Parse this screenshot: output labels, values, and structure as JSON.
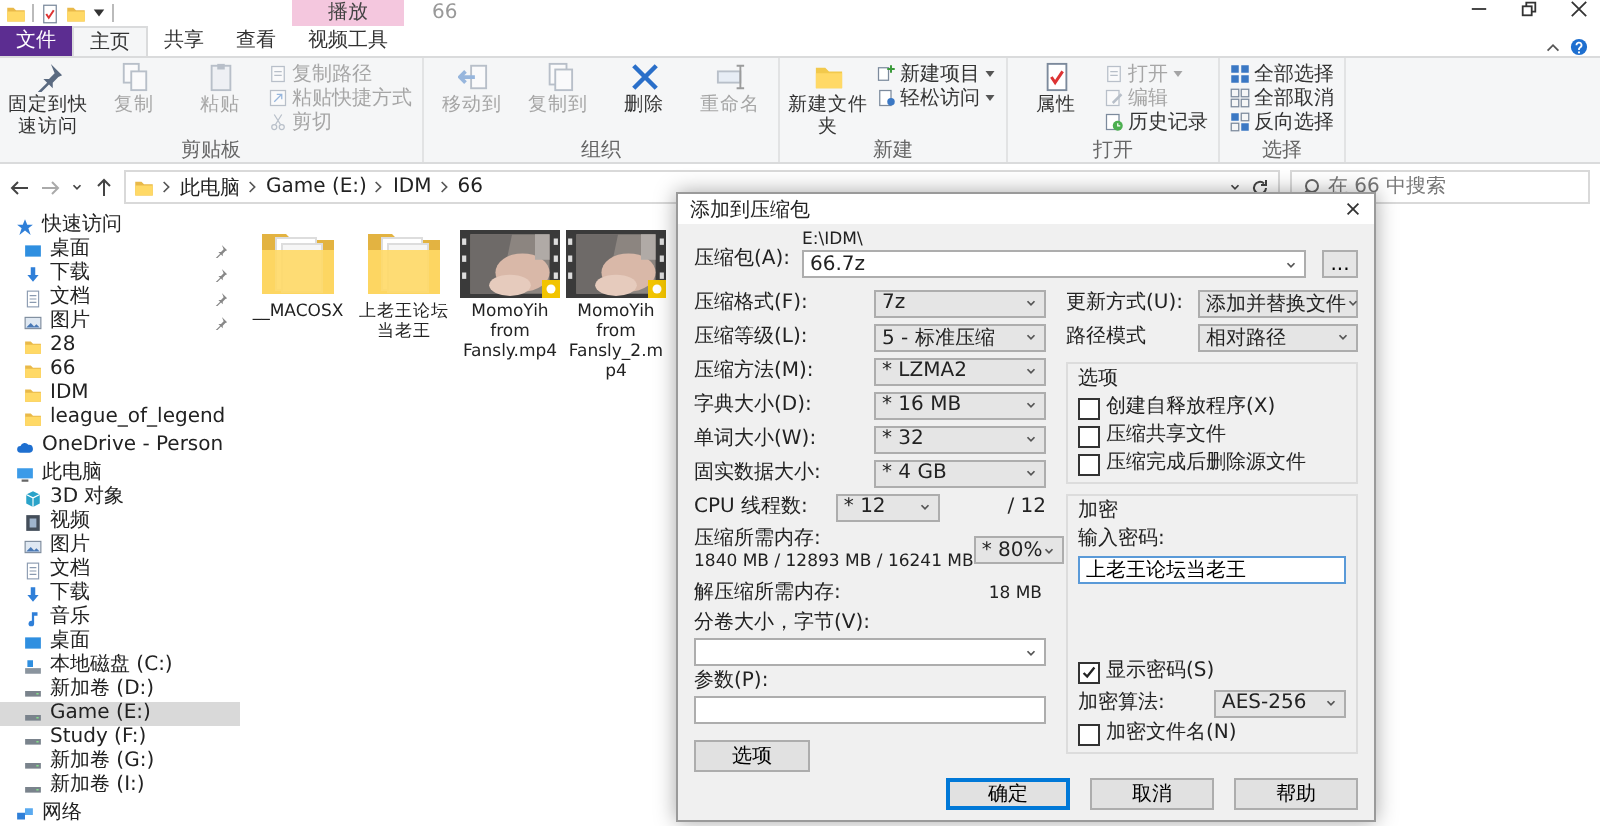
{
  "title_bar": {
    "title": "66"
  },
  "tabs": [
    {
      "label": "文件",
      "kind": "menu",
      "selected": false
    },
    {
      "label": "主页",
      "kind": "tab",
      "selected": true
    },
    {
      "label": "共享",
      "kind": "tab",
      "selected": false
    },
    {
      "label": "查看",
      "kind": "tab",
      "selected": false
    },
    {
      "label": "视频工具",
      "kind": "contextual",
      "header": "播放",
      "selected": false
    }
  ],
  "ribbon": {
    "groups": [
      {
        "label": "剪贴板",
        "large": [
          {
            "label": "固定到快速访问",
            "kind": "pin",
            "disabled": false
          },
          {
            "label": "复制",
            "kind": "copy",
            "disabled": true
          },
          {
            "label": "粘贴",
            "kind": "paste",
            "disabled": true
          }
        ],
        "small": [
          {
            "label": "复制路径",
            "kind": "path",
            "disabled": true,
            "dropdown": false
          },
          {
            "label": "粘贴快捷方式",
            "kind": "shortcut",
            "disabled": true,
            "dropdown": false
          },
          {
            "label": "剪切",
            "kind": "cut",
            "disabled": true,
            "dropdown": false
          }
        ]
      },
      {
        "label": "组织",
        "large": [
          {
            "label": "移动到",
            "kind": "move",
            "disabled": true
          },
          {
            "label": "复制到",
            "kind": "copyto",
            "disabled": true
          },
          {
            "label": "删除",
            "kind": "delete",
            "disabled": false
          },
          {
            "label": "重命名",
            "kind": "rename",
            "disabled": true
          }
        ]
      },
      {
        "label": "新建",
        "large": [
          {
            "label": "新建文件夹",
            "kind": "newfolder",
            "disabled": false
          }
        ],
        "small": [
          {
            "label": "新建项目",
            "kind": "newitem",
            "disabled": false,
            "dropdown": true
          },
          {
            "label": "轻松访问",
            "kind": "easy",
            "disabled": false,
            "dropdown": true
          }
        ]
      },
      {
        "label": "打开",
        "large": [
          {
            "label": "属性",
            "kind": "props",
            "disabled": false
          }
        ],
        "small": [
          {
            "label": "打开",
            "kind": "open",
            "disabled": true,
            "dropdown": true
          },
          {
            "label": "编辑",
            "kind": "edit",
            "disabled": true,
            "dropdown": false
          },
          {
            "label": "历史记录",
            "kind": "history",
            "disabled": false,
            "dropdown": false
          }
        ]
      },
      {
        "label": "选择",
        "small": [
          {
            "label": "全部选择",
            "kind": "selectall",
            "disabled": false,
            "dropdown": false
          },
          {
            "label": "全部取消",
            "kind": "selectnone",
            "disabled": false,
            "dropdown": false
          },
          {
            "label": "反向选择",
            "kind": "invert",
            "disabled": false,
            "dropdown": false
          }
        ]
      }
    ]
  },
  "address_bar": {
    "crumbs": [
      "此电脑",
      "Game (E:)",
      "IDM",
      "66"
    ],
    "search_placeholder": "在 66 中搜索"
  },
  "sidebar": {
    "sections": [
      {
        "label": "快速访问",
        "kind": "star",
        "selected": false,
        "children": [
          {
            "label": "桌面",
            "kind": "desktop",
            "pinned": true,
            "selected": false
          },
          {
            "label": "下载",
            "kind": "download",
            "pinned": true,
            "selected": false
          },
          {
            "label": "文档",
            "kind": "doc",
            "pinned": true,
            "selected": false
          },
          {
            "label": "图片",
            "kind": "picture",
            "pinned": true,
            "selected": false
          },
          {
            "label": "28",
            "kind": "folder",
            "pinned": false,
            "selected": false
          },
          {
            "label": "66",
            "kind": "folder",
            "pinned": false,
            "selected": false
          },
          {
            "label": "IDM",
            "kind": "folder",
            "pinned": false,
            "selected": false
          },
          {
            "label": "league_of_legend",
            "kind": "folder",
            "pinned": false,
            "selected": false
          }
        ]
      },
      {
        "label": "OneDrive - Person",
        "kind": "cloud",
        "selected": false
      },
      {
        "label": "此电脑",
        "kind": "pc",
        "selected": false,
        "children": [
          {
            "label": "3D 对象",
            "kind": "cube",
            "pinned": false,
            "selected": false
          },
          {
            "label": "视频",
            "kind": "video",
            "pinned": false,
            "selected": false
          },
          {
            "label": "图片",
            "kind": "picture",
            "pinned": false,
            "selected": false
          },
          {
            "label": "文档",
            "kind": "doc",
            "pinned": false,
            "selected": false
          },
          {
            "label": "下载",
            "kind": "download",
            "pinned": false,
            "selected": false
          },
          {
            "label": "音乐",
            "kind": "music",
            "pinned": false,
            "selected": false
          },
          {
            "label": "桌面",
            "kind": "desktop",
            "pinned": false,
            "selected": false
          },
          {
            "label": "本地磁盘 (C:)",
            "kind": "sysdrive",
            "pinned": false,
            "selected": false
          },
          {
            "label": "新加卷 (D:)",
            "kind": "drive",
            "pinned": false,
            "selected": false
          },
          {
            "label": "Game (E:)",
            "kind": "drive",
            "pinned": false,
            "selected": true
          },
          {
            "label": "Study (F:)",
            "kind": "drive",
            "pinned": false,
            "selected": false
          },
          {
            "label": "新加卷 (G:)",
            "kind": "drive",
            "pinned": false,
            "selected": false
          },
          {
            "label": "新加卷 (I:)",
            "kind": "drive",
            "pinned": false,
            "selected": false
          }
        ]
      },
      {
        "label": "网络",
        "kind": "network",
        "selected": false
      }
    ]
  },
  "files": [
    {
      "name": "__MACOSX",
      "kind": "folder"
    },
    {
      "name": "上老王论坛当老王",
      "kind": "folder"
    },
    {
      "name": "MomoYih from Fansly.mp4",
      "kind": "video"
    },
    {
      "name": "MomoYih from Fansly_2.mp4",
      "kind": "video"
    }
  ],
  "dialog": {
    "title": "添加到压缩包",
    "archive": {
      "label": "压缩包(A):",
      "path": "E:\\IDM\\",
      "value": "66.7z",
      "browse": "..."
    },
    "left_fields": [
      {
        "kind": "combo",
        "label": "压缩格式(F):",
        "value": "7z"
      },
      {
        "kind": "combo",
        "label": "压缩等级(L):",
        "value": "5 - 标准压缩"
      },
      {
        "kind": "combo",
        "label": "压缩方法(M):",
        "value": "* LZMA2"
      },
      {
        "kind": "combo",
        "label": "字典大小(D):",
        "value": "* 16 MB"
      },
      {
        "kind": "combo",
        "label": "单词大小(W):",
        "value": "* 32"
      },
      {
        "kind": "combo",
        "label": "固实数据大小:",
        "value": "* 4 GB"
      },
      {
        "kind": "short_combo",
        "label": "CPU 线程数:",
        "value": "* 12",
        "suffix": "/ 12"
      },
      {
        "kind": "memory",
        "label": "压缩所需内存:",
        "detail": "1840 MB / 12893 MB / 16241 MB",
        "value": "* 80%"
      },
      {
        "kind": "reading",
        "label": "解压缩所需内存:",
        "value": "18 MB"
      },
      {
        "kind": "wide_combo",
        "label": "分卷大小，字节(V):"
      },
      {
        "kind": "wide_input",
        "label": "参数(P):"
      }
    ],
    "options_button": "选项",
    "right_fields": [
      {
        "label": "更新方式(U):",
        "value": "添加并替换文件"
      },
      {
        "label": "路径模式",
        "value": "相对路径"
      }
    ],
    "options_group": {
      "title": "选项",
      "checks": [
        {
          "label": "创建自释放程序(X)",
          "checked": false
        },
        {
          "label": "压缩共享文件",
          "checked": false
        },
        {
          "label": "压缩完成后删除源文件",
          "checked": false
        }
      ]
    },
    "encryption": {
      "title": "加密",
      "password_label": "输入密码:",
      "password": "上老王论坛当老王",
      "show_password": {
        "label": "显示密码(S)",
        "checked": true
      },
      "method": {
        "label": "加密算法:",
        "value": "AES-256"
      },
      "encrypt_names": {
        "label": "加密文件名(N)",
        "checked": false
      }
    },
    "buttons": [
      {
        "label": "确定",
        "default": true
      },
      {
        "label": "取消",
        "default": false
      },
      {
        "label": "帮助",
        "default": false
      }
    ]
  }
}
